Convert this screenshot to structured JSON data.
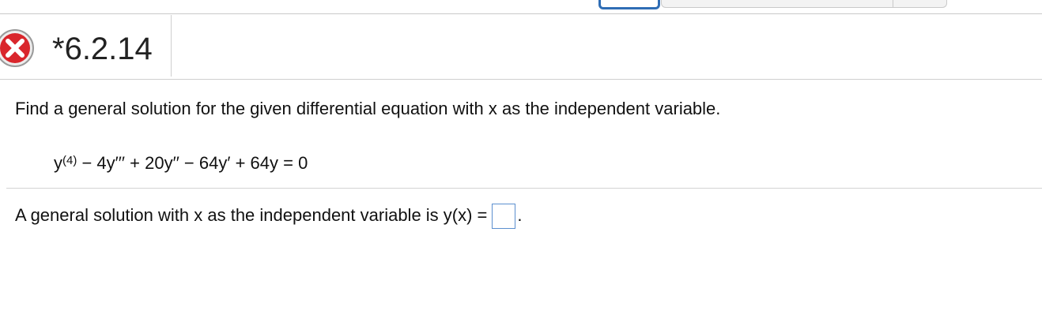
{
  "header": {
    "problem_number": "*6.2.14",
    "status_icon": "incorrect-x-icon"
  },
  "question": {
    "instruction": "Find a general solution for the given differential equation with x as the independent variable.",
    "equation": {
      "base": "y",
      "superscript": "(4)",
      "rest": " − 4y′′′ + 20y′′ − 64y′ + 64y = 0"
    }
  },
  "answer": {
    "prompt": "A general solution with x as the independent variable is y(x) =",
    "value": "",
    "suffix": "."
  },
  "colors": {
    "status_icon_fill": "#d9262c",
    "status_icon_ring": "#9a9a9a",
    "tab_active_accent": "#2f6db5",
    "answer_box_border": "#5c8fcf"
  }
}
